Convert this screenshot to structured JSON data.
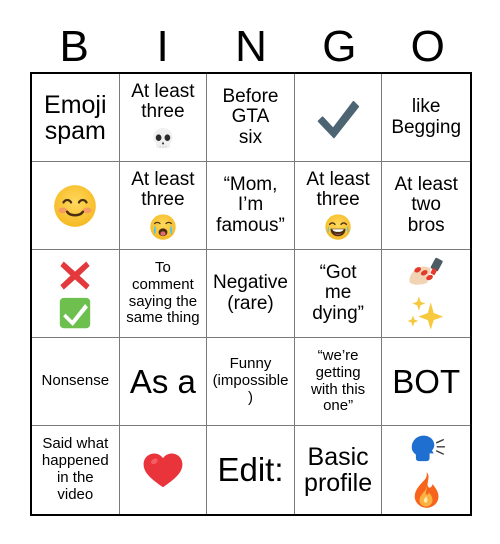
{
  "card": {
    "title": "BINGO",
    "header_letters": [
      "B",
      "I",
      "N",
      "G",
      "O"
    ],
    "columns": 5,
    "rows": 5,
    "colors": {
      "border_outer": "#000000",
      "border_inner": "#7a7a7a",
      "background": "#ffffff",
      "text": "#000000",
      "check_emoji": "#4d6472",
      "cross_emoji": "#e4393c",
      "green_check_box": "#6ec04e",
      "heart": "#e8343a",
      "speaking_head": "#1f6fd0",
      "fire_outer": "#f7641c",
      "fire_inner": "#fbb040",
      "sparkles": "#f7c93e",
      "nail_polish": "#4d5b63"
    },
    "cells": [
      {
        "id": "b1",
        "column": "B",
        "row": 1,
        "text": "Emoji\nspam",
        "size": "sz-lg",
        "emoji": null,
        "emoji_name": null
      },
      {
        "id": "i1",
        "column": "I",
        "row": 1,
        "text": "At least\nthree",
        "size": "sz-md",
        "emoji": "skull",
        "emoji_name": "skull-emoji"
      },
      {
        "id": "n1",
        "column": "N",
        "row": 1,
        "text": "Before\nGTA\nsix",
        "size": "sz-md",
        "emoji": null,
        "emoji_name": null
      },
      {
        "id": "g1",
        "column": "G",
        "row": 1,
        "text": "",
        "size": "sz-md",
        "emoji": "check",
        "emoji_name": "heavy-check-mark-emoji"
      },
      {
        "id": "o1",
        "column": "O",
        "row": 1,
        "text": "like\nBegging",
        "size": "sz-md",
        "emoji": null,
        "emoji_name": null
      },
      {
        "id": "b2",
        "column": "B",
        "row": 2,
        "text": "",
        "size": "sz-md",
        "emoji": "smile-blush",
        "emoji_name": "smiling-face-with-smiling-eyes-emoji"
      },
      {
        "id": "i2",
        "column": "I",
        "row": 2,
        "text": "At least\nthree",
        "size": "sz-md",
        "emoji": "sob",
        "emoji_name": "loudly-crying-face-emoji"
      },
      {
        "id": "n2",
        "column": "N",
        "row": 2,
        "text": "“Mom,\nI’m\nfamous”",
        "size": "sz-md",
        "emoji": null,
        "emoji_name": null
      },
      {
        "id": "g2",
        "column": "G",
        "row": 2,
        "text": "At least\nthree",
        "size": "sz-md",
        "emoji": "joy",
        "emoji_name": "face-with-tears-of-joy-emoji"
      },
      {
        "id": "o2",
        "column": "O",
        "row": 2,
        "text": "At least\ntwo\nbros",
        "size": "sz-md",
        "emoji": null,
        "emoji_name": null
      },
      {
        "id": "b3",
        "column": "B",
        "row": 3,
        "text": "",
        "size": "sz-md",
        "emoji": "cross-and-check",
        "emoji_name": "cross-mark-and-check-mark-button-emoji"
      },
      {
        "id": "i3",
        "column": "I",
        "row": 3,
        "text": "To\ncomment\nsaying the\nsame thing",
        "size": "sz-sm",
        "emoji": null,
        "emoji_name": null
      },
      {
        "id": "n3",
        "column": "N",
        "row": 3,
        "text": "Negative\n(rare)",
        "size": "sz-md",
        "emoji": null,
        "emoji_name": null
      },
      {
        "id": "g3",
        "column": "G",
        "row": 3,
        "text": "“Got\nme\ndying”",
        "size": "sz-md",
        "emoji": null,
        "emoji_name": null
      },
      {
        "id": "o3",
        "column": "O",
        "row": 3,
        "text": "",
        "size": "sz-md",
        "emoji": "nails-and-sparkles",
        "emoji_name": "nail-polish-and-sparkles-emoji"
      },
      {
        "id": "b4",
        "column": "B",
        "row": 4,
        "text": "Nonsense",
        "size": "sz-sm",
        "emoji": null,
        "emoji_name": null
      },
      {
        "id": "i4",
        "column": "I",
        "row": 4,
        "text": "As a",
        "size": "sz-xxl",
        "emoji": null,
        "emoji_name": null
      },
      {
        "id": "n4",
        "column": "N",
        "row": 4,
        "text": "Funny\n(impossible)",
        "size": "sz-sm",
        "emoji": null,
        "emoji_name": null
      },
      {
        "id": "g4",
        "column": "G",
        "row": 4,
        "text": "“we’re\ngetting\nwith this\none”",
        "size": "sz-sm",
        "emoji": null,
        "emoji_name": null
      },
      {
        "id": "o4",
        "column": "O",
        "row": 4,
        "text": "BOT",
        "size": "sz-xxl",
        "emoji": null,
        "emoji_name": null
      },
      {
        "id": "b5",
        "column": "B",
        "row": 5,
        "text": "Said what\nhappened\nin the\nvideo",
        "size": "sz-sm",
        "emoji": null,
        "emoji_name": null
      },
      {
        "id": "i5",
        "column": "I",
        "row": 5,
        "text": "",
        "size": "sz-md",
        "emoji": "heart",
        "emoji_name": "red-heart-emoji"
      },
      {
        "id": "n5",
        "column": "N",
        "row": 5,
        "text": "Edit:",
        "size": "sz-xxl",
        "emoji": null,
        "emoji_name": null
      },
      {
        "id": "g5",
        "column": "G",
        "row": 5,
        "text": "Basic\nprofile",
        "size": "sz-lg",
        "emoji": null,
        "emoji_name": null
      },
      {
        "id": "o5",
        "column": "O",
        "row": 5,
        "text": "",
        "size": "sz-md",
        "emoji": "speak-and-fire",
        "emoji_name": "speaking-head-and-fire-emoji"
      }
    ]
  }
}
